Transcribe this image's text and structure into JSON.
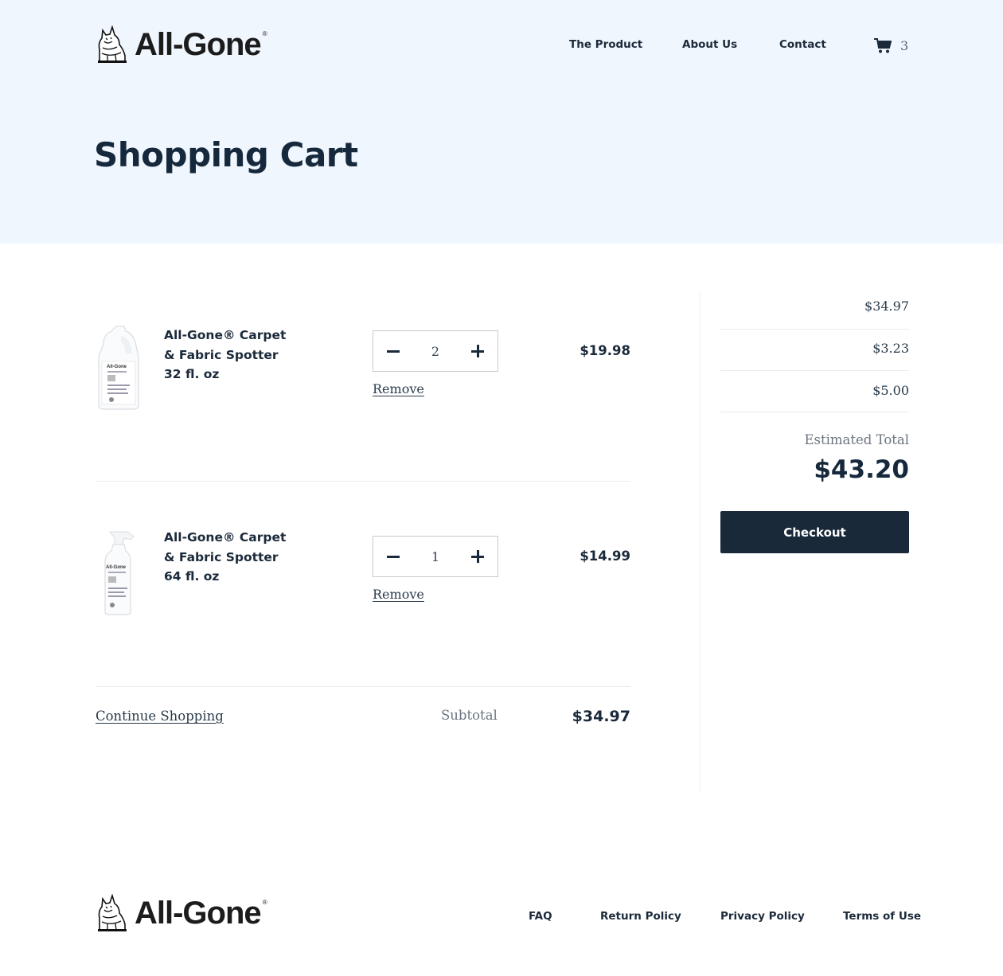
{
  "brand": {
    "name": "All-Gone",
    "registered": "®"
  },
  "header": {
    "nav": [
      {
        "label": "The Product"
      },
      {
        "label": "About Us"
      },
      {
        "label": "Contact"
      }
    ],
    "cart": {
      "icon": "cart-icon",
      "count": "3"
    }
  },
  "page": {
    "title": "Shopping Cart"
  },
  "cart": {
    "items": [
      {
        "image_icon": "gallon-jug-product-image",
        "name_line1": "All-Gone® Carpet",
        "name_line2": "& Fabric Spotter",
        "name_line3": "32 fl. oz",
        "quantity": "2",
        "remove_label": "Remove",
        "price": "$19.98"
      },
      {
        "image_icon": "spray-bottle-product-image",
        "name_line1": "All-Gone® Carpet",
        "name_line2": "& Fabric Spotter",
        "name_line3": "64 fl. oz",
        "quantity": "1",
        "remove_label": "Remove",
        "price": "$14.99"
      }
    ],
    "continue_label": "Continue Shopping",
    "subtotal_label": "Subtotal",
    "subtotal_value": "$34.97"
  },
  "summary": {
    "rows": [
      {
        "value": "$34.97"
      },
      {
        "value": "$3.23"
      },
      {
        "value": "$5.00"
      }
    ],
    "estimated_total_label": "Estimated Total",
    "estimated_total_value": "$43.20",
    "checkout_label": "Checkout"
  },
  "footer": {
    "links": [
      {
        "label": "FAQ"
      },
      {
        "label": "Return Policy"
      },
      {
        "label": "Privacy Policy"
      },
      {
        "label": "Terms of Use"
      }
    ]
  },
  "colors": {
    "hero_bg": "#f0f6fe",
    "primary_text": "#1b2a3a",
    "checkout_bg": "#19293a",
    "muted_text": "#6b7480"
  }
}
